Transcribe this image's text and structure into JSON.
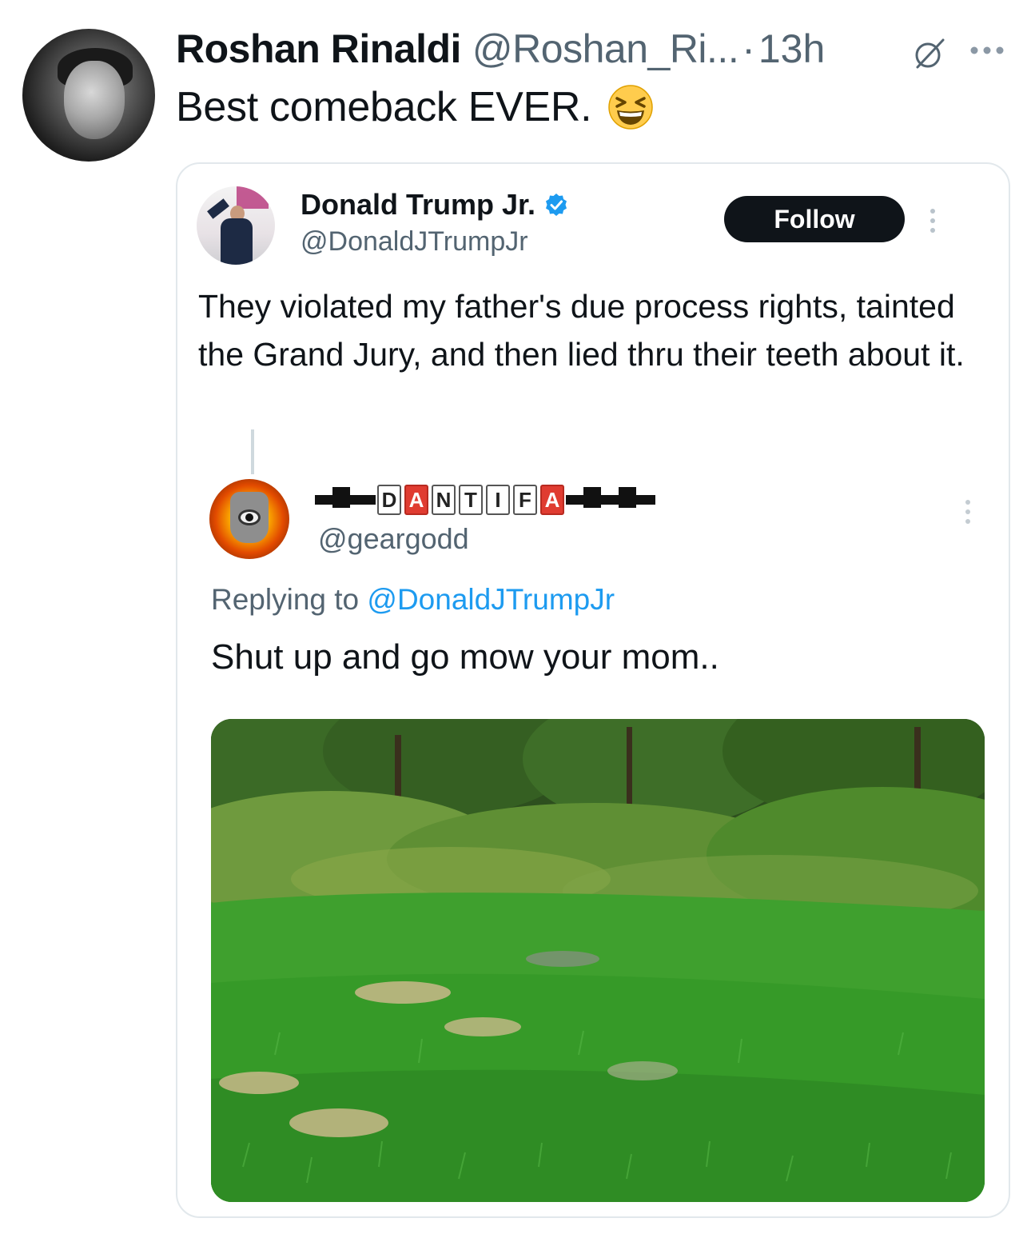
{
  "outer_tweet": {
    "author_name": "Roshan Rinaldi",
    "author_handle": "@Roshan_Ri...",
    "separator": "·",
    "time": "13h",
    "text": "Best comeback EVER.",
    "emoji": "grinning-squinting-face",
    "icons": [
      "grok-icon",
      "more-horizontal-icon"
    ]
  },
  "quoted": {
    "author_name": "Donald Trump Jr.",
    "author_handle": "@DonaldJTrumpJr",
    "verified": true,
    "follow_label": "Follow",
    "text": "They violated my father's due process rights, tainted the Grand Jury, and then lied thru their teeth about it."
  },
  "reply": {
    "name_letters": [
      "D",
      "A",
      "N",
      "T",
      "I",
      "F",
      "A"
    ],
    "author_handle": "@geargodd",
    "replying_prefix": "Replying to ",
    "replying_to": "@DonaldJTrumpJr",
    "text": "Shut up and go mow your mom..",
    "photo": "grass-field-photo"
  },
  "colors": {
    "text_primary": "#0f1419",
    "text_secondary": "#536471",
    "link": "#1d9bf0",
    "verified": "#1d9bf0",
    "follow_bg": "#0f1419"
  }
}
